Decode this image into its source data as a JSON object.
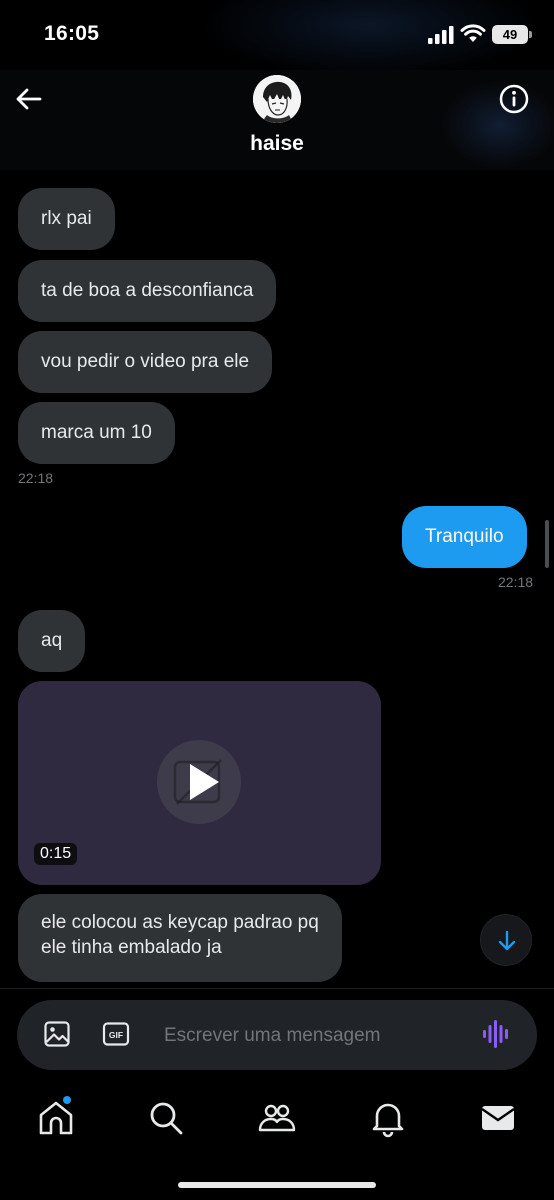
{
  "status_bar": {
    "time": "16:05",
    "battery": "49"
  },
  "header": {
    "contact_name": "haise"
  },
  "messages": [
    {
      "text": "rlx pai"
    },
    {
      "text": "ta de boa a desconfianca"
    },
    {
      "text": "vou pedir o video pra ele"
    },
    {
      "text": "marca um 10"
    },
    {
      "time": "22:18"
    },
    {
      "text": "Tranquilo"
    },
    {
      "time": "22:18"
    },
    {
      "text": "aq"
    },
    {
      "video_duration": "0:15"
    },
    {
      "text_line1": "ele colocou as keycap padrao pq",
      "text_line2": "ele tinha embalado ja"
    }
  ],
  "composer": {
    "placeholder": "Escrever uma mensagem"
  },
  "icons": {
    "back": "arrow-left-icon",
    "info": "info-icon",
    "play": "play-icon",
    "scroll_down": "arrow-down-icon",
    "image": "image-icon",
    "gif": "gif-icon",
    "voice": "voice-waveform-icon",
    "tabs": [
      "home-icon",
      "search-icon",
      "communities-icon",
      "notifications-icon",
      "messages-icon"
    ]
  },
  "colors": {
    "accent": "#1d9bf0",
    "incoming_bubble": "#2f3336",
    "voice_icon": "#8b5cf6",
    "video_bg": "#2f2a40"
  }
}
